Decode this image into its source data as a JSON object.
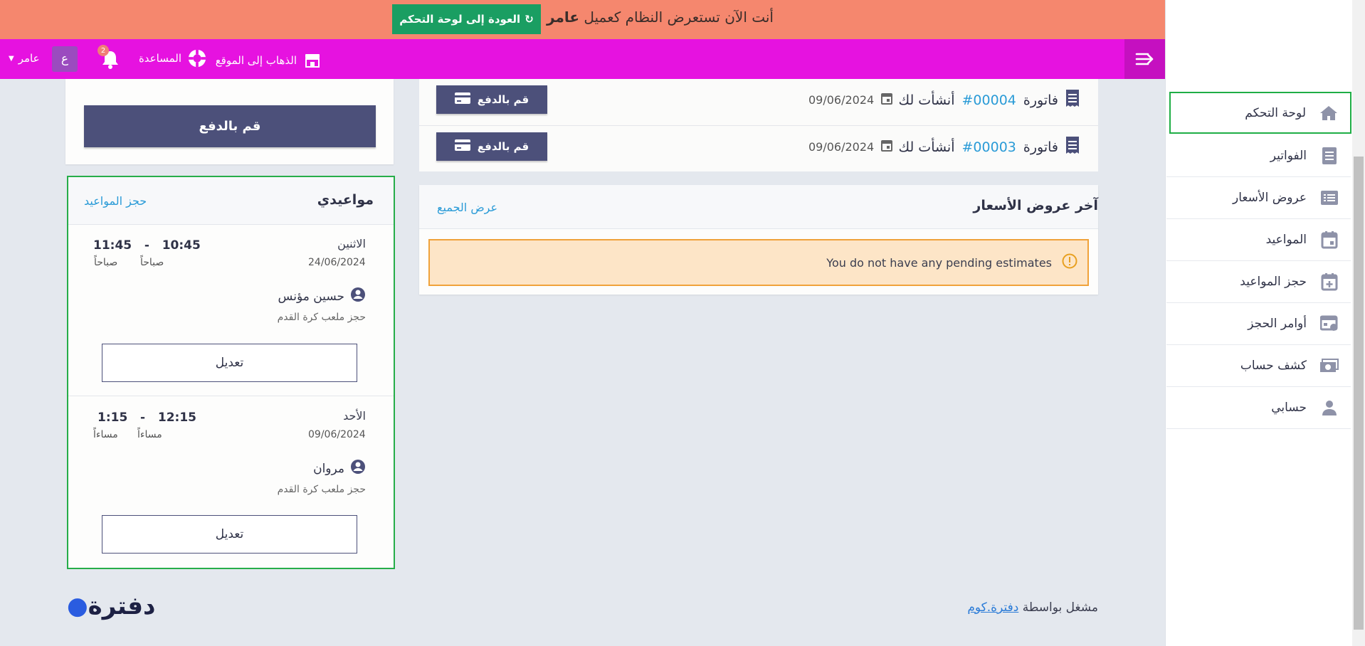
{
  "banner": {
    "text_prefix": "أنت الآن تستعرض النظام كعميل",
    "client_name": "عامر",
    "back_button": "العودة إلى لوحة التحكم"
  },
  "topnav": {
    "go_to_site": "الذهاب إلى الموقع",
    "help": "المساعدة",
    "notification_count": "2",
    "avatar_letter": "ع",
    "user_name": "عامر"
  },
  "sidebar": {
    "items": [
      {
        "label": "لوحة التحكم",
        "icon": "home-icon",
        "active": true
      },
      {
        "label": "الفواتير",
        "icon": "invoice-icon"
      },
      {
        "label": "عروض الأسعار",
        "icon": "estimates-icon"
      },
      {
        "label": "المواعيد",
        "icon": "calendar-icon"
      },
      {
        "label": "حجز المواعيد",
        "icon": "calendar-plus-icon"
      },
      {
        "label": "أوامر الحجز",
        "icon": "booking-orders-icon"
      },
      {
        "label": "كشف حساب",
        "icon": "money-icon"
      },
      {
        "label": "حسابي",
        "icon": "user-icon"
      }
    ]
  },
  "invoices": [
    {
      "title_prefix": "فاتورة",
      "number": "#00004",
      "title_suffix": "أنشأت لك",
      "date": "09/06/2024",
      "pay_label": "قم بالدفع"
    },
    {
      "title_prefix": "فاتورة",
      "number": "#00003",
      "title_suffix": "أنشأت لك",
      "date": "09/06/2024",
      "pay_label": "قم بالدفع"
    }
  ],
  "pay_card": {
    "button": "قم بالدفع"
  },
  "estimates": {
    "title": "آخر عروض الأسعار",
    "view_all": "عرض الجميع",
    "empty_message": "You do not have any pending estimates"
  },
  "appointments": {
    "title": "مواعيدي",
    "book_link": "حجز المواعيد",
    "items": [
      {
        "day": "الاثنين",
        "date": "24/06/2024",
        "start": "10:45",
        "end": "11:45",
        "start_period": "صباحاً",
        "end_period": "صباحاً",
        "client": "حسين مؤنس",
        "service": "حجز ملعب كرة القدم",
        "edit": "تعديل"
      },
      {
        "day": "الأحد",
        "date": "09/06/2024",
        "start": "12:15",
        "end": "1:15",
        "start_period": "مساءاً",
        "end_period": "مساءاً",
        "client": "مروان",
        "service": "حجز ملعب كرة القدم",
        "edit": "تعديل"
      }
    ]
  },
  "footer": {
    "powered_by": "مشغل بواسطة",
    "link": "دفترة.كوم",
    "logo_text": "دفترة"
  }
}
